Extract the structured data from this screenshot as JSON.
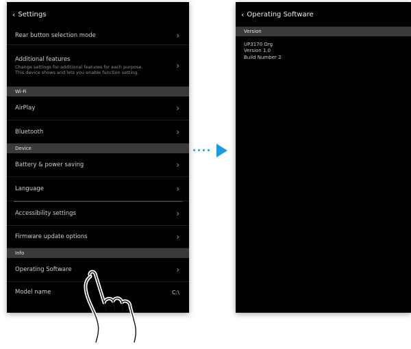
{
  "left_screen": {
    "back_label": "Settings",
    "rows_top": [
      {
        "label": "Rear button selection mode"
      },
      {
        "label": "Additional features",
        "subtitle": "Change settings for additional features for each purpose. This device shows and lets you enable function setting."
      }
    ],
    "section_1": "Wi-Fi",
    "rows_1": [
      {
        "label": "AirPlay"
      },
      {
        "label": "Bluetooth"
      }
    ],
    "section_2": "Device",
    "rows_2": [
      {
        "label": "Battery & power saving"
      },
      {
        "label": "Language"
      }
    ],
    "rows_3": [
      {
        "label": "Accessibility settings"
      },
      {
        "label": "Firmware update options"
      }
    ],
    "section_3": "Info",
    "rows_4": [
      {
        "label": "Operating Software",
        "arrow": true
      },
      {
        "label": "Model name",
        "value": "C:\\"
      }
    ]
  },
  "right_screen": {
    "back_label": "Operating Software",
    "section": "Version",
    "info_lines": [
      "UP3170 Org",
      "Version 1.0",
      "Build Number 2"
    ]
  },
  "icons": {
    "chevron_left": "‹",
    "chevron_right": "›"
  },
  "accent_color": "#1a9be0"
}
